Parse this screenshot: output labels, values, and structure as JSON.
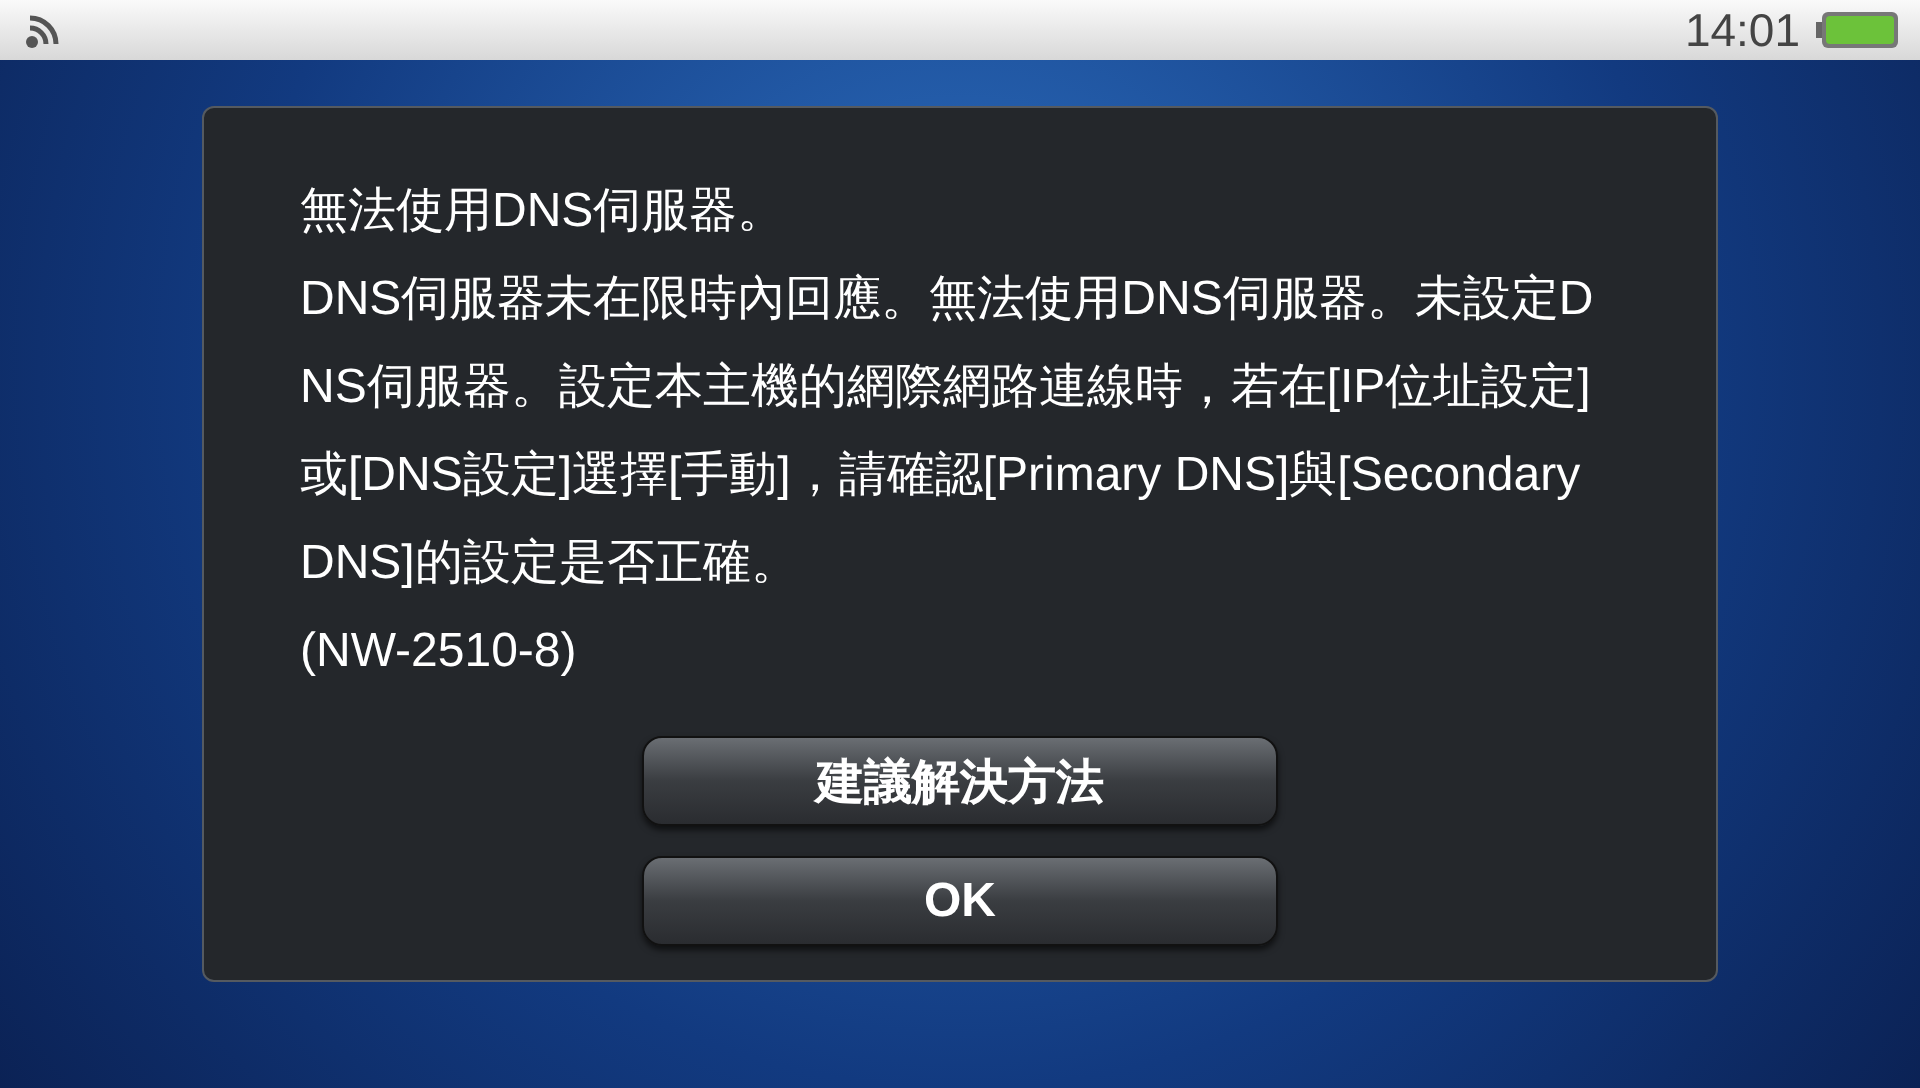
{
  "status_bar": {
    "time": "14:01"
  },
  "dialog": {
    "title": "無法使用DNS伺服器。",
    "message": "DNS伺服器未在限時內回應。無法使用DNS伺服器。未設定DNS伺服器。設定本主機的網際網路連線時，若在[IP位址設定]或[DNS設定]選擇[手動]，請確認[Primary DNS]與[Secondary DNS]的設定是否正確。",
    "error_code": "(NW-2510-8)",
    "buttons": [
      "建議解決方法",
      "OK"
    ]
  }
}
